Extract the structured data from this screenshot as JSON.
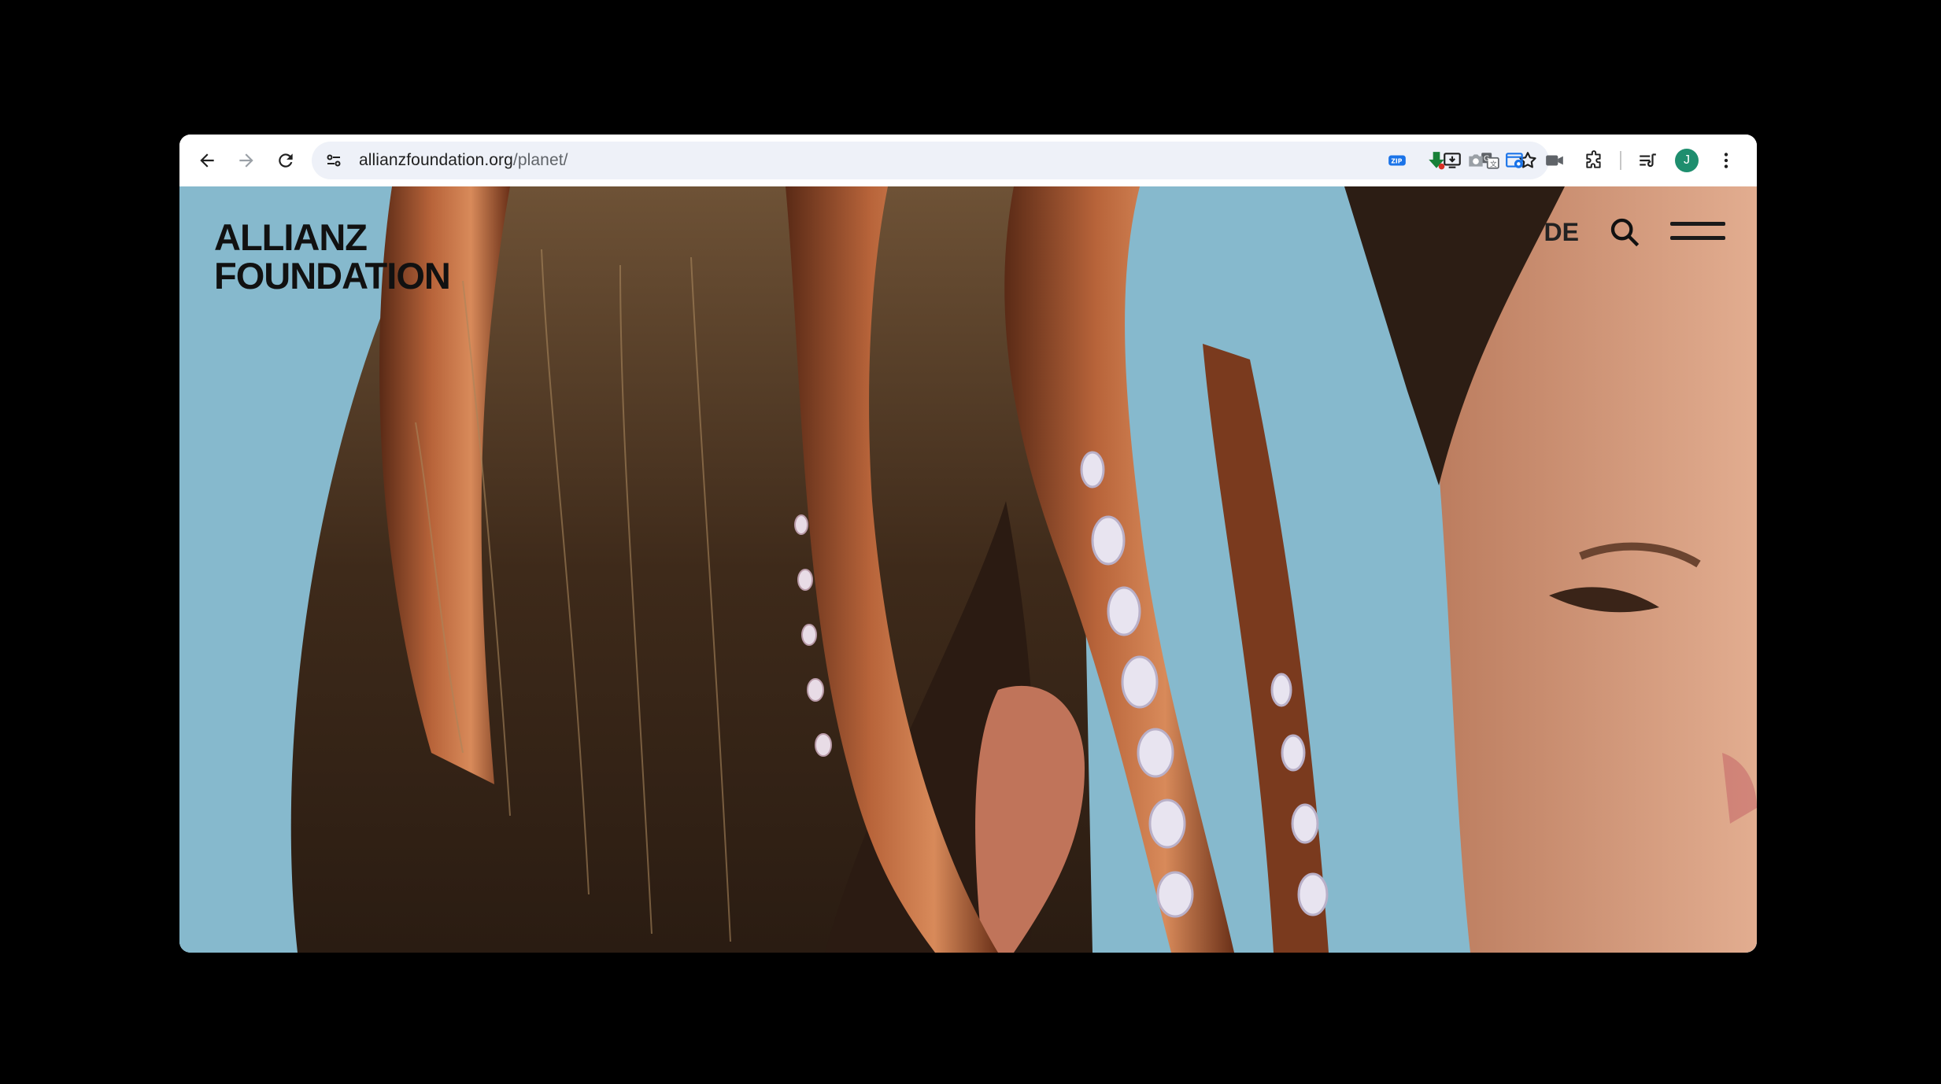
{
  "browser": {
    "url_host": "allianzfoundation.org",
    "url_path": "/planet/",
    "profile_initial": "J",
    "colors": {
      "omnibox_bg": "#eef1f8",
      "avatar_bg": "#1e8e6e"
    },
    "toolbar_icons": [
      "back-icon",
      "forward-icon",
      "reload-icon",
      "site-info-icon",
      "install-app-icon",
      "translate-icon",
      "bookmark-star-icon",
      "zip-extension-icon",
      "download-extension-icon",
      "camera-extension-icon",
      "screen-capture-extension-icon",
      "video-extension-icon",
      "extensions-puzzle-icon",
      "reading-list-icon",
      "more-menu-icon"
    ]
  },
  "site": {
    "logo_line1": "ALLIANZ",
    "logo_line2": "FOUNDATION",
    "language": "DE",
    "icons": [
      "search-icon",
      "hamburger-menu-icon"
    ]
  }
}
